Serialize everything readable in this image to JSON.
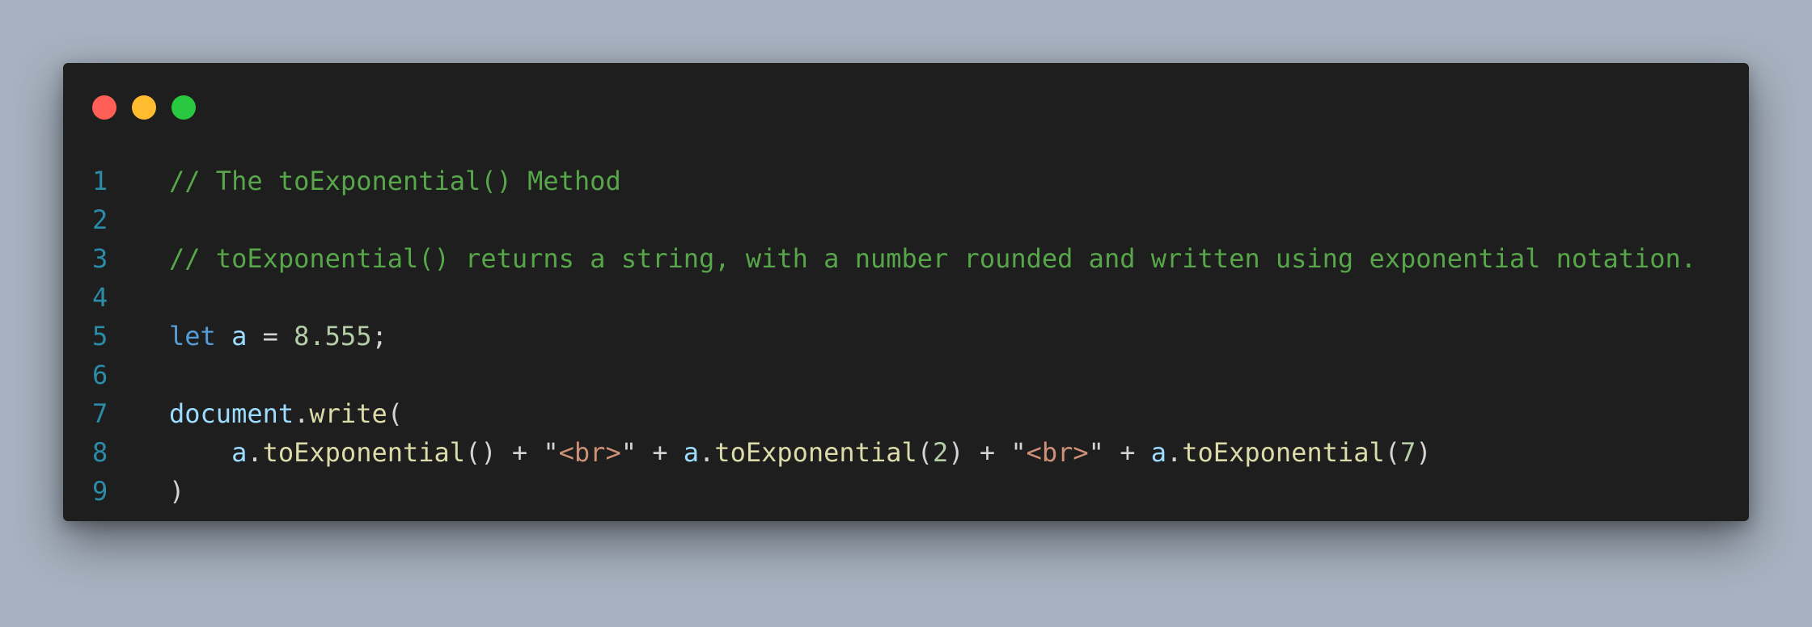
{
  "window": {
    "controls": {
      "close_color": "#ff5f57",
      "minimize_color": "#febc2e",
      "maximize_color": "#28c840"
    }
  },
  "code": {
    "language": "javascript",
    "lines": [
      {
        "number": "1",
        "text": "// The toExponential() Method"
      },
      {
        "number": "2",
        "text": ""
      },
      {
        "number": "3",
        "text": "// toExponential() returns a string, with a number rounded and written using exponential notation."
      },
      {
        "number": "4",
        "text": ""
      },
      {
        "number": "5",
        "text": "let a = 8.555;"
      },
      {
        "number": "6",
        "text": ""
      },
      {
        "number": "7",
        "text": "document.write("
      },
      {
        "number": "8",
        "text": "    a.toExponential() + \"<br>\" + a.toExponential(2) + \"<br>\" + a.toExponential(7)"
      },
      {
        "number": "9",
        "text": ")"
      }
    ],
    "tokens": {
      "line1_comment": "// The toExponential() Method",
      "line3_comment": "// toExponential() returns a string, with a number rounded and written using exponential notation.",
      "line5_kw": "let",
      "line5_sp1": " ",
      "line5_var": "a",
      "line5_eq": " = ",
      "line5_num": "8.555",
      "line5_semi": ";",
      "line7_obj": "document",
      "line7_dot": ".",
      "line7_fn": "write",
      "line7_paren": "(",
      "line8_indent": "    ",
      "line8_var1": "a",
      "line8_dot1": ".",
      "line8_fn1": "toExponential",
      "line8_p1": "() + \"",
      "line8_str1": "<br>",
      "line8_p2": "\" + ",
      "line8_var2": "a",
      "line8_dot2": ".",
      "line8_fn2": "toExponential",
      "line8_p3": "(",
      "line8_num2": "2",
      "line8_p4": ") + \"",
      "line8_str2": "<br>",
      "line8_p5": "\" + ",
      "line8_var3": "a",
      "line8_dot3": ".",
      "line8_fn3": "toExponential",
      "line8_p6": "(",
      "line8_num3": "7",
      "line8_p7": ")",
      "line9_paren": ")"
    }
  },
  "colors": {
    "background": "#a7b1bf",
    "editor_bg": "#1e1e1e",
    "line_number": "#2b8ca8",
    "comment": "#57a64a",
    "keyword": "#569cd6",
    "variable": "#9cdcfe",
    "number": "#b5cea8",
    "function": "#dcdcaa",
    "string": "#ce9178",
    "punctuation": "#d4d4d4"
  }
}
